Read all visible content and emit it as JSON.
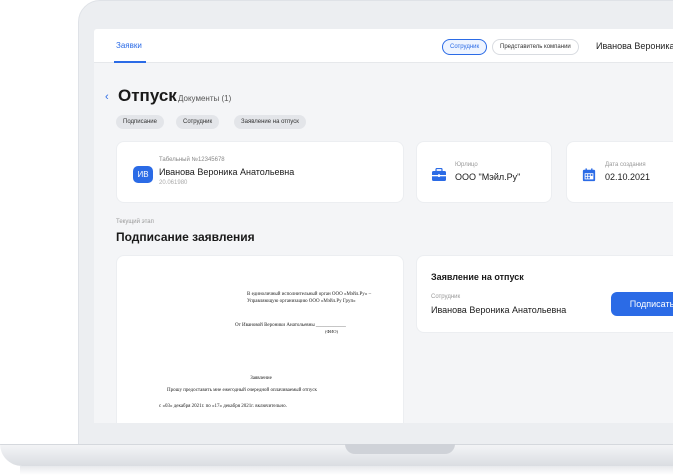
{
  "header": {
    "nav_link": "Заявки",
    "role_employee": "Сотрудник",
    "role_company": "Представитель компании",
    "user_name": "Иванова Вероника"
  },
  "page": {
    "back_icon": "chevron-left-icon",
    "title": "Отпуск",
    "docs_link": "Документы (1)",
    "tags": [
      "Подписание",
      "Сотрудник",
      "Заявление на отпуск"
    ]
  },
  "employee_card": {
    "avatar": "ИВ",
    "number_label": "Табельный №12345678",
    "name": "Иванова Вероника Анатольевна",
    "date": "20.061980"
  },
  "org_card": {
    "icon": "briefcase-icon",
    "label": "Юрлицо",
    "value": "ООО \"Мэйл.Ру\""
  },
  "date_card": {
    "icon": "calendar-icon",
    "label": "Дата создания",
    "value": "02.10.2021"
  },
  "step": {
    "label": "Текущий этап",
    "title": "Подписание заявления"
  },
  "document": {
    "address": "В единоличный исполнительный орган ООО «Мэйл.Ру» – Управляющую организацию ООО «Мэйл.Ру Груп»",
    "from": "От Ивановой Вероники Анатольевны ____________",
    "fio": "(ФИО)",
    "heading": "Заявление",
    "body_line1": "Прошу предоставить мне ежегодный очередной оплачиваемый отпуск",
    "body_line2": "с «03» декабря 2021г. по «17» декабря 2021г. включительно."
  },
  "sign_card": {
    "title": "Заявление на отпуск",
    "label": "Сотрудник",
    "name": "Иванова Вероника Анатольевна",
    "button": "Подписать"
  },
  "colors": {
    "accent": "#2b6be6",
    "background": "#f4f5f7"
  }
}
